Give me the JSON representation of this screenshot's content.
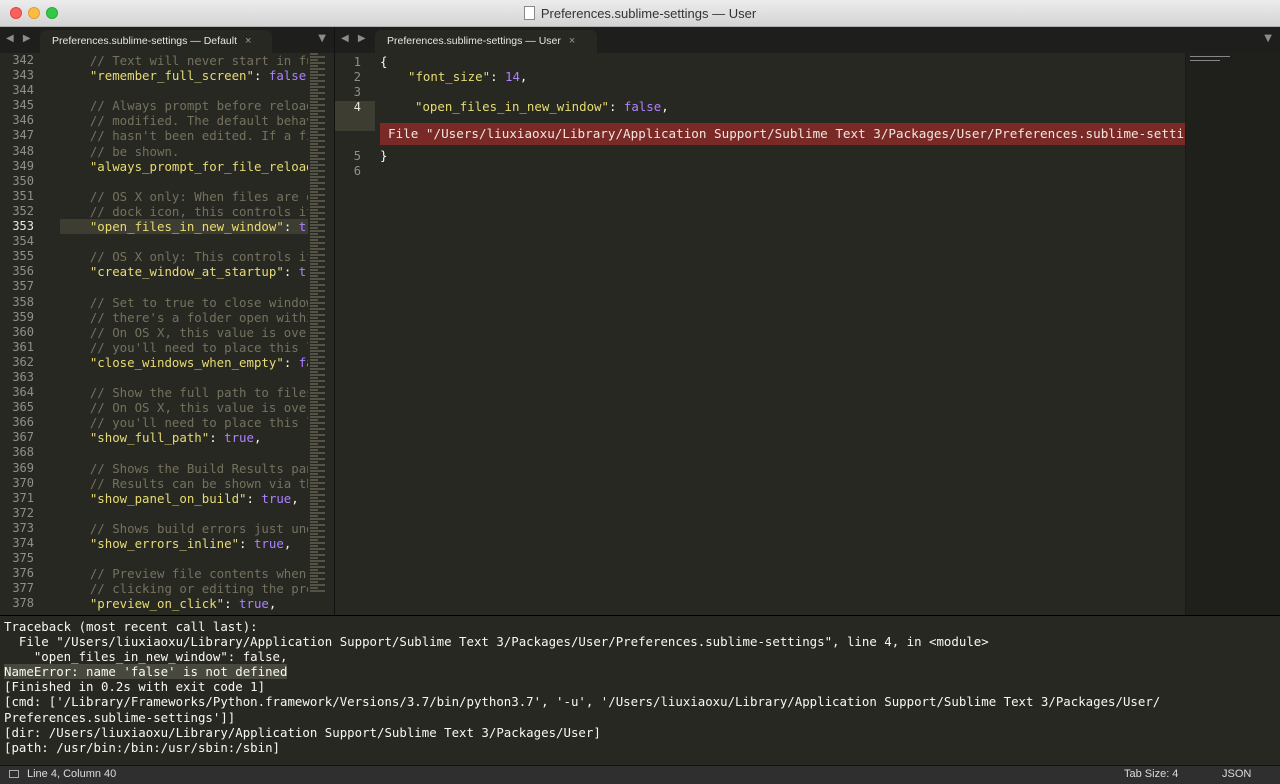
{
  "window": {
    "title": "Preferences.sublime-settings — User"
  },
  "left_pane": {
    "tab_label": "Preferences.sublime-settings — Default",
    "current_line": "353",
    "lines": [
      {
        "n": "342",
        "parts": [
          {
            "t": "    "
          },
          {
            "t": "// Text will never start in full",
            "c": "cmt"
          }
        ]
      },
      {
        "n": "343",
        "parts": [
          {
            "t": "    "
          },
          {
            "t": "\"remember_full_screen\"",
            "c": "str"
          },
          {
            "t": ": "
          },
          {
            "t": "false",
            "c": "bool"
          },
          {
            "t": ","
          }
        ]
      },
      {
        "n": "344",
        "parts": []
      },
      {
        "n": "345",
        "parts": [
          {
            "t": "    "
          },
          {
            "t": "// Always prompt before reloading",
            "c": "cmt"
          }
        ]
      },
      {
        "n": "346",
        "parts": [
          {
            "t": "    "
          },
          {
            "t": "// modified. The default behavior",
            "c": "cmt"
          }
        ]
      },
      {
        "n": "347",
        "parts": [
          {
            "t": "    "
          },
          {
            "t": "// hasn't been edited. If a file",
            "c": "cmt"
          }
        ]
      },
      {
        "n": "348",
        "parts": [
          {
            "t": "    "
          },
          {
            "t": "// be shown.",
            "c": "cmt"
          }
        ]
      },
      {
        "n": "349",
        "parts": [
          {
            "t": "    "
          },
          {
            "t": "\"always_prompt_for_file_reload\"",
            "c": "str"
          },
          {
            "t": ":"
          }
        ]
      },
      {
        "n": "350",
        "parts": []
      },
      {
        "n": "351",
        "parts": [
          {
            "t": "    "
          },
          {
            "t": "// OS X only: When files are ope",
            "c": "cmt"
          }
        ]
      },
      {
        "n": "352",
        "parts": [
          {
            "t": "    "
          },
          {
            "t": "// dock icon, this controls if a",
            "c": "cmt"
          }
        ]
      },
      {
        "n": "353",
        "parts": [
          {
            "t": "    "
          },
          {
            "t": "\"open_files_in_new_window\"",
            "c": "str"
          },
          {
            "t": ": "
          },
          {
            "t": "true",
            "c": "bool"
          }
        ]
      },
      {
        "n": "354",
        "parts": []
      },
      {
        "n": "355",
        "parts": [
          {
            "t": "    "
          },
          {
            "t": "// OS X only: This controls if a",
            "c": "cmt"
          }
        ]
      },
      {
        "n": "356",
        "parts": [
          {
            "t": "    "
          },
          {
            "t": "\"create_window_at_startup\"",
            "c": "str"
          },
          {
            "t": ": "
          },
          {
            "t": "true",
            "c": "bool"
          }
        ]
      },
      {
        "n": "357",
        "parts": []
      },
      {
        "n": "358",
        "parts": [
          {
            "t": "    "
          },
          {
            "t": "// Set to true to close windows",
            "c": "cmt"
          }
        ]
      },
      {
        "n": "359",
        "parts": [
          {
            "t": "    "
          },
          {
            "t": "// there's a folder open within",
            "c": "cmt"
          }
        ]
      },
      {
        "n": "360",
        "parts": [
          {
            "t": "    "
          },
          {
            "t": "// On OS X, this value is overri",
            "c": "cmt"
          }
        ]
      },
      {
        "n": "361",
        "parts": [
          {
            "t": "    "
          },
          {
            "t": "// you'll need to place this lin",
            "c": "cmt"
          }
        ]
      },
      {
        "n": "362",
        "parts": [
          {
            "t": "    "
          },
          {
            "t": "\"close_windows_when_empty\"",
            "c": "str"
          },
          {
            "t": ": "
          },
          {
            "t": "false",
            "c": "bool"
          }
        ]
      },
      {
        "n": "363",
        "parts": []
      },
      {
        "n": "364",
        "parts": [
          {
            "t": "    "
          },
          {
            "t": "// Show the full path to files i",
            "c": "cmt"
          }
        ]
      },
      {
        "n": "365",
        "parts": [
          {
            "t": "    "
          },
          {
            "t": "// On OS X, this value is overri",
            "c": "cmt"
          }
        ]
      },
      {
        "n": "366",
        "parts": [
          {
            "t": "    "
          },
          {
            "t": "// you'll need to place this lin",
            "c": "cmt"
          }
        ]
      },
      {
        "n": "367",
        "parts": [
          {
            "t": "    "
          },
          {
            "t": "\"show_full_path\"",
            "c": "str"
          },
          {
            "t": ": "
          },
          {
            "t": "true",
            "c": "bool"
          },
          {
            "t": ","
          }
        ]
      },
      {
        "n": "368",
        "parts": []
      },
      {
        "n": "369",
        "parts": [
          {
            "t": "    "
          },
          {
            "t": "// Shows the Build Results panel",
            "c": "cmt"
          }
        ]
      },
      {
        "n": "370",
        "parts": [
          {
            "t": "    "
          },
          {
            "t": "// Results can be shown via the",
            "c": "cmt"
          }
        ]
      },
      {
        "n": "371",
        "parts": [
          {
            "t": "    "
          },
          {
            "t": "\"show_panel_on_build\"",
            "c": "str"
          },
          {
            "t": ": "
          },
          {
            "t": "true",
            "c": "bool"
          },
          {
            "t": ","
          }
        ]
      },
      {
        "n": "372",
        "parts": []
      },
      {
        "n": "373",
        "parts": [
          {
            "t": "    "
          },
          {
            "t": "// Shows build errors just under",
            "c": "cmt"
          }
        ]
      },
      {
        "n": "374",
        "parts": [
          {
            "t": "    "
          },
          {
            "t": "\"show_errors_inline\"",
            "c": "str"
          },
          {
            "t": ": "
          },
          {
            "t": "true",
            "c": "bool"
          },
          {
            "t": ","
          }
        ]
      },
      {
        "n": "375",
        "parts": []
      },
      {
        "n": "376",
        "parts": [
          {
            "t": "    "
          },
          {
            "t": "// Preview file contents when cl",
            "c": "cmt"
          }
        ]
      },
      {
        "n": "377",
        "parts": [
          {
            "t": "    "
          },
          {
            "t": "// clicking or editing the previ",
            "c": "cmt"
          }
        ]
      },
      {
        "n": "378",
        "parts": [
          {
            "t": "    "
          },
          {
            "t": "\"preview_on_click\"",
            "c": "str"
          },
          {
            "t": ": "
          },
          {
            "t": "true",
            "c": "bool"
          },
          {
            "t": ","
          }
        ]
      }
    ]
  },
  "right_pane": {
    "tab_label": "Preferences.sublime-settings — User",
    "line_numbers": [
      "1",
      "2",
      "3",
      "4",
      "5",
      "6"
    ],
    "line1": "{",
    "line2_key": "\"font_size\"",
    "line2_sep": ": ",
    "line2_val": "14",
    "line2_end": ",",
    "line4_key": "\"open_files_in_new_window\"",
    "line4_sep": ": ",
    "line4_val": "false",
    "line4_end": ",",
    "error_text": "File \"/Users/liuxiaoxu/Library/Application Support/Sublime Text 3/Packages/User/Preferences.sublime-settings\"",
    "line5": "}"
  },
  "console": {
    "lines": [
      "Traceback (most recent call last):",
      "  File \"/Users/liuxiaoxu/Library/Application Support/Sublime Text 3/Packages/User/Preferences.sublime-settings\", line 4, in <module>",
      "    \"open_files_in_new_window\": false,",
      "NameError: name 'false' is not defined",
      "[Finished in 0.2s with exit code 1]",
      "[cmd: ['/Library/Frameworks/Python.framework/Versions/3.7/bin/python3.7', '-u', '/Users/liuxiaoxu/Library/Application Support/Sublime Text 3/Packages/User/",
      "Preferences.sublime-settings']]",
      "[dir: /Users/liuxiaoxu/Library/Application Support/Sublime Text 3/Packages/User]",
      "[path: /usr/bin:/bin:/usr/sbin:/sbin]"
    ]
  },
  "status_bar": {
    "position": "Line 4, Column 40",
    "tab_size": "Tab Size: 4",
    "syntax": "JSON"
  },
  "colors": {
    "background": "#272822",
    "comment": "#75715e",
    "string": "#e6db74",
    "constant": "#ae81ff",
    "error_bar": "#7a2a26"
  }
}
